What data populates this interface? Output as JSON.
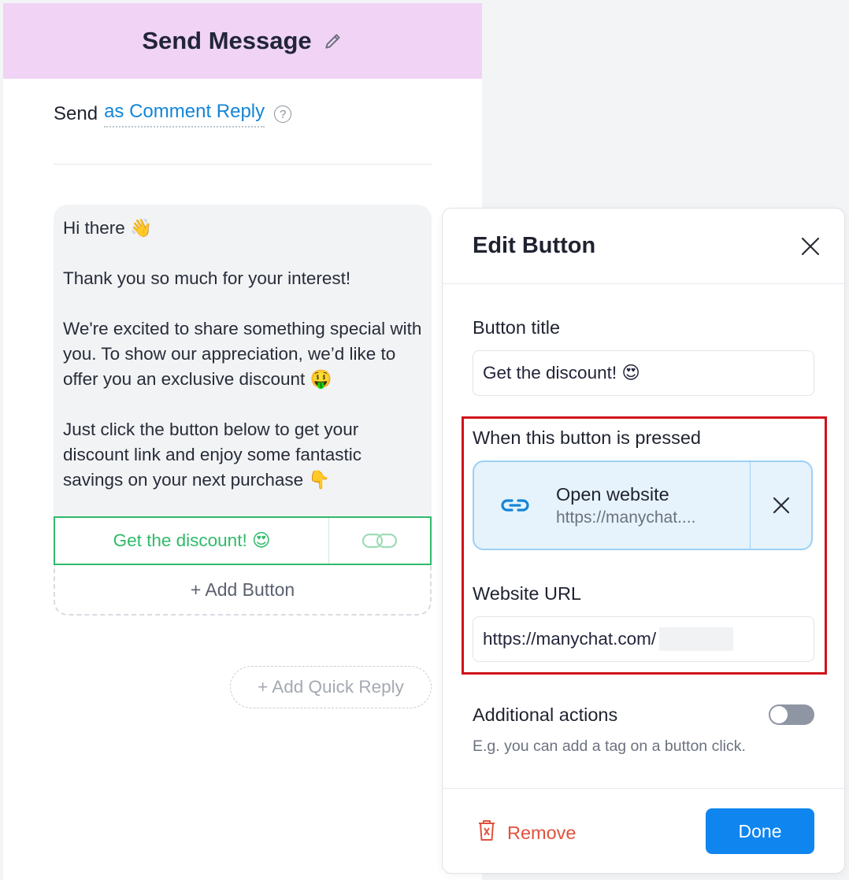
{
  "card": {
    "title": "Send Message",
    "send_prefix": "Send",
    "send_mode": "as Comment Reply",
    "help_glyph": "?",
    "message": "Hi there 👋\n\nThank you so much for your interest!\n\nWe're excited to share something special with you. To show our appreciation, we’d like to offer you an exclusive discount 🤑\n\nJust click the button below to get your discount link and enjoy some fantastic savings on your next purchase 👇",
    "button_label": "Get the discount! 😍",
    "add_button": "+ Add Button",
    "add_quick_reply": "+ Add Quick Reply"
  },
  "panel": {
    "title": "Edit Button",
    "button_title_label": "Button title",
    "button_title_value": "Get the discount! 😍",
    "pressed_label": "When this button is pressed",
    "action_title": "Open website",
    "action_url": "https://manychat....",
    "website_url_label": "Website URL",
    "website_url_value": "https://manychat.com/",
    "additional_label": "Additional actions",
    "additional_hint": "E.g. you can add a tag on a button click.",
    "additional_enabled": false,
    "remove_label": "Remove",
    "done_label": "Done"
  },
  "colors": {
    "header_bg": "#f0d3f5",
    "link_blue": "#1485d6",
    "button_green": "#2fbb6a",
    "highlight_red": "#d0121b",
    "primary_blue": "#0f85f0",
    "remove_red": "#e0523d"
  },
  "icons": [
    "pencil-icon",
    "help-icon",
    "link-icon",
    "close-icon",
    "trash-icon"
  ]
}
